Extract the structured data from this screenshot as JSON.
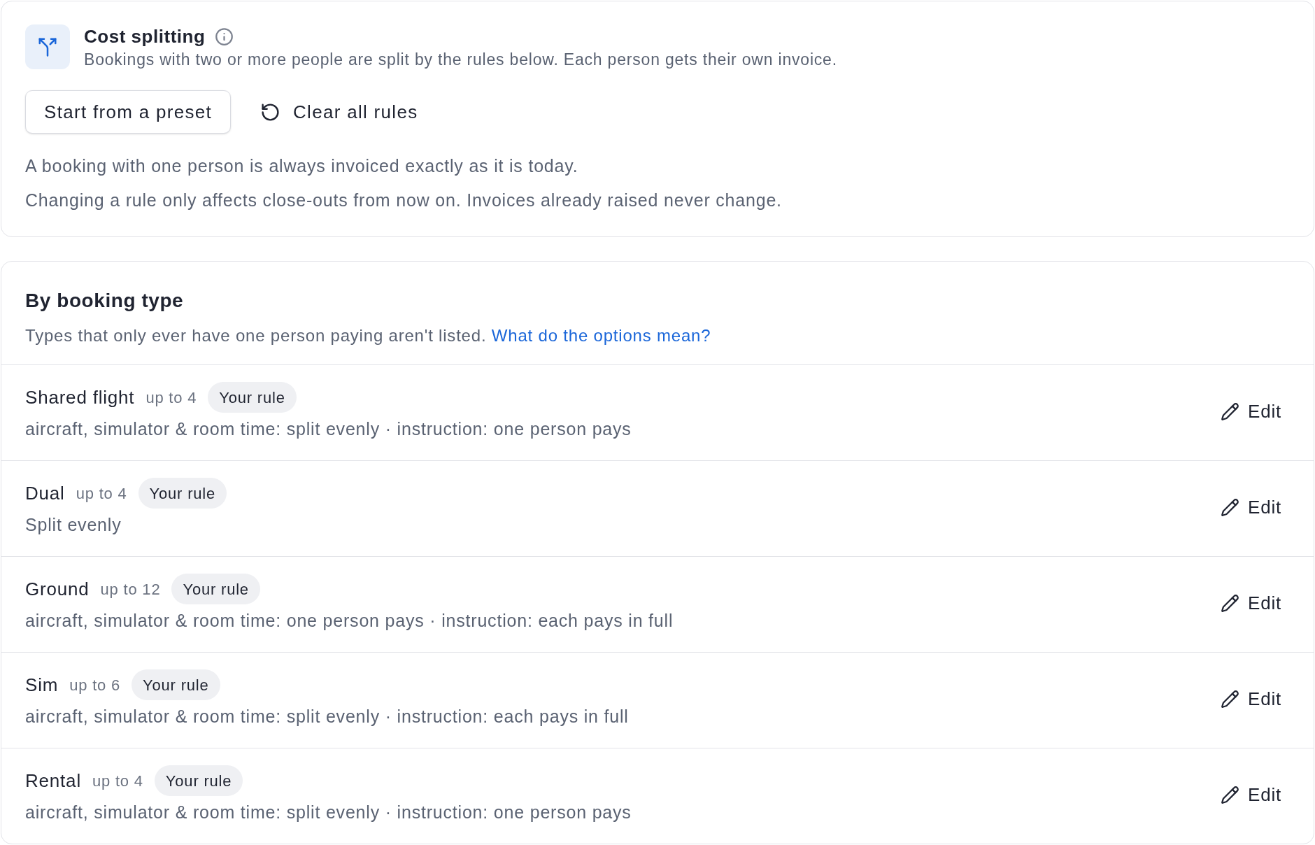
{
  "header": {
    "title": "Cost splitting",
    "subtitle": "Bookings with two or more people are split by the rules below. Each person gets their own invoice.",
    "buttons": [
      {
        "kind": "outline",
        "label": "Start from a preset"
      },
      {
        "kind": "reset",
        "label": "Clear all rules"
      }
    ],
    "notes": [
      "A booking with one person is always invoiced exactly as it is today.",
      "Changing a rule only affects close-outs from now on. Invoices already raised never change."
    ]
  },
  "booking_types": {
    "title": "By booking type",
    "description": "Types that only ever have one person paying aren't listed.",
    "link": "What do the options mean?",
    "rows": [
      {
        "name": "Shared flight",
        "limit": "up to 4",
        "badge": "Your rule",
        "summary": "aircraft, simulator & room time: split evenly · instruction: one person pays",
        "action": "Edit"
      },
      {
        "name": "Dual",
        "limit": "up to 4",
        "badge": "Your rule",
        "summary": "Split evenly",
        "action": "Edit"
      },
      {
        "name": "Ground",
        "limit": "up to 12",
        "badge": "Your rule",
        "summary": "aircraft, simulator & room time: one person pays · instruction: each pays in full",
        "action": "Edit"
      },
      {
        "name": "Sim",
        "limit": "up to 6",
        "badge": "Your rule",
        "summary": "aircraft, simulator & room time: split evenly · instruction: each pays in full",
        "action": "Edit"
      },
      {
        "name": "Rental",
        "limit": "up to 4",
        "badge": "Your rule",
        "summary": "aircraft, simulator & room time: split evenly · instruction: one person pays",
        "action": "Edit"
      }
    ]
  }
}
